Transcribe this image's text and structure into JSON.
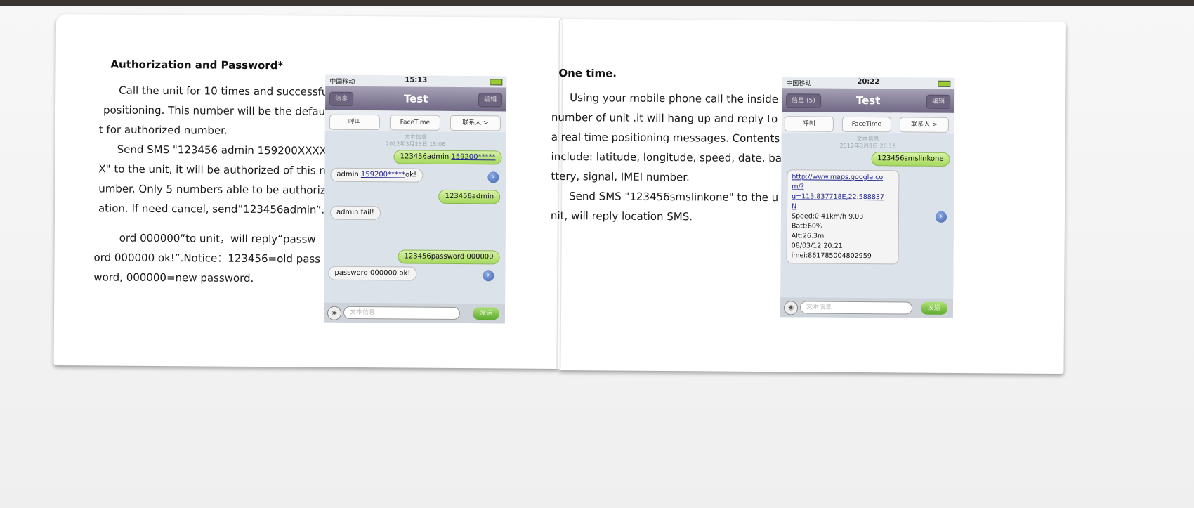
{
  "left_page": {
    "heading": "Authorization and Password*",
    "paragraph1": [
      "Call the unit for 10 times and successful",
      "positioning. This number will be the defaul",
      "t for authorized number.",
      "Send SMS \"123456 admin 159200XXXX",
      "X\" to the unit, it will be authorized of this n",
      "umber. Only 5 numbers able to be authoriz",
      "ation. If need cancel, send”123456admin”."
    ],
    "paragraph2": [
      "ord 000000”to unit，will reply“passw",
      "ord 000000 ok!”.Notice：123456=old pass",
      "word, 000000=new password."
    ]
  },
  "right_page": {
    "heading": "One time.",
    "paragraph": [
      "Using your mobile phone call the inside",
      "number of unit .it will hang up and reply to",
      "a real time positioning messages. Contents",
      "include: latitude, longitude, speed, date, ba",
      "ttery, signal, IMEI number.",
      "Send SMS \"123456smslinkone\" to the u",
      "nit, will reply location SMS."
    ]
  },
  "phone1": {
    "carrier": "中国移动",
    "time": "15:13",
    "back_label": "信息",
    "title": "Test",
    "edit_label": "编辑",
    "actions": [
      "呼叫",
      "FaceTime",
      "联系人 >"
    ],
    "stamp_1": "文本信息",
    "stamp_2": "2012年3月23日 15:06",
    "messages": {
      "m1_prefix": "123456admin ",
      "m1_link": "159200*****",
      "m2_prefix": "admin ",
      "m2_link": "159200*****",
      "m2_suffix": "ok!",
      "m3": "123456admin",
      "m4": "admin fail!",
      "m5": "123456password 000000",
      "m6": "password 000000 ok!"
    },
    "input_placeholder": "文本信息",
    "send_label": "发送"
  },
  "phone2": {
    "carrier": "中国移动",
    "time": "20:22",
    "back_label": "信息 (5)",
    "title": "Test",
    "edit_label": "编辑",
    "actions": [
      "呼叫",
      "FaceTime",
      "联系人 >"
    ],
    "stamp_1": "文本信息",
    "stamp_2": "2012年3月8日 20:18",
    "out_message": "123456smslinkone",
    "reply": {
      "link_lines": [
        "http://www.maps.google.co",
        "m/?",
        "q=113.837718E,22.588837",
        "N"
      ],
      "lines": [
        "Speed:0.41km/h 9.03",
        "Batt:60%",
        "Alt:26.3m",
        "08/03/12 20:21",
        "imei:861785004802959"
      ]
    },
    "input_placeholder": "文本信息",
    "send_label": "发送"
  }
}
